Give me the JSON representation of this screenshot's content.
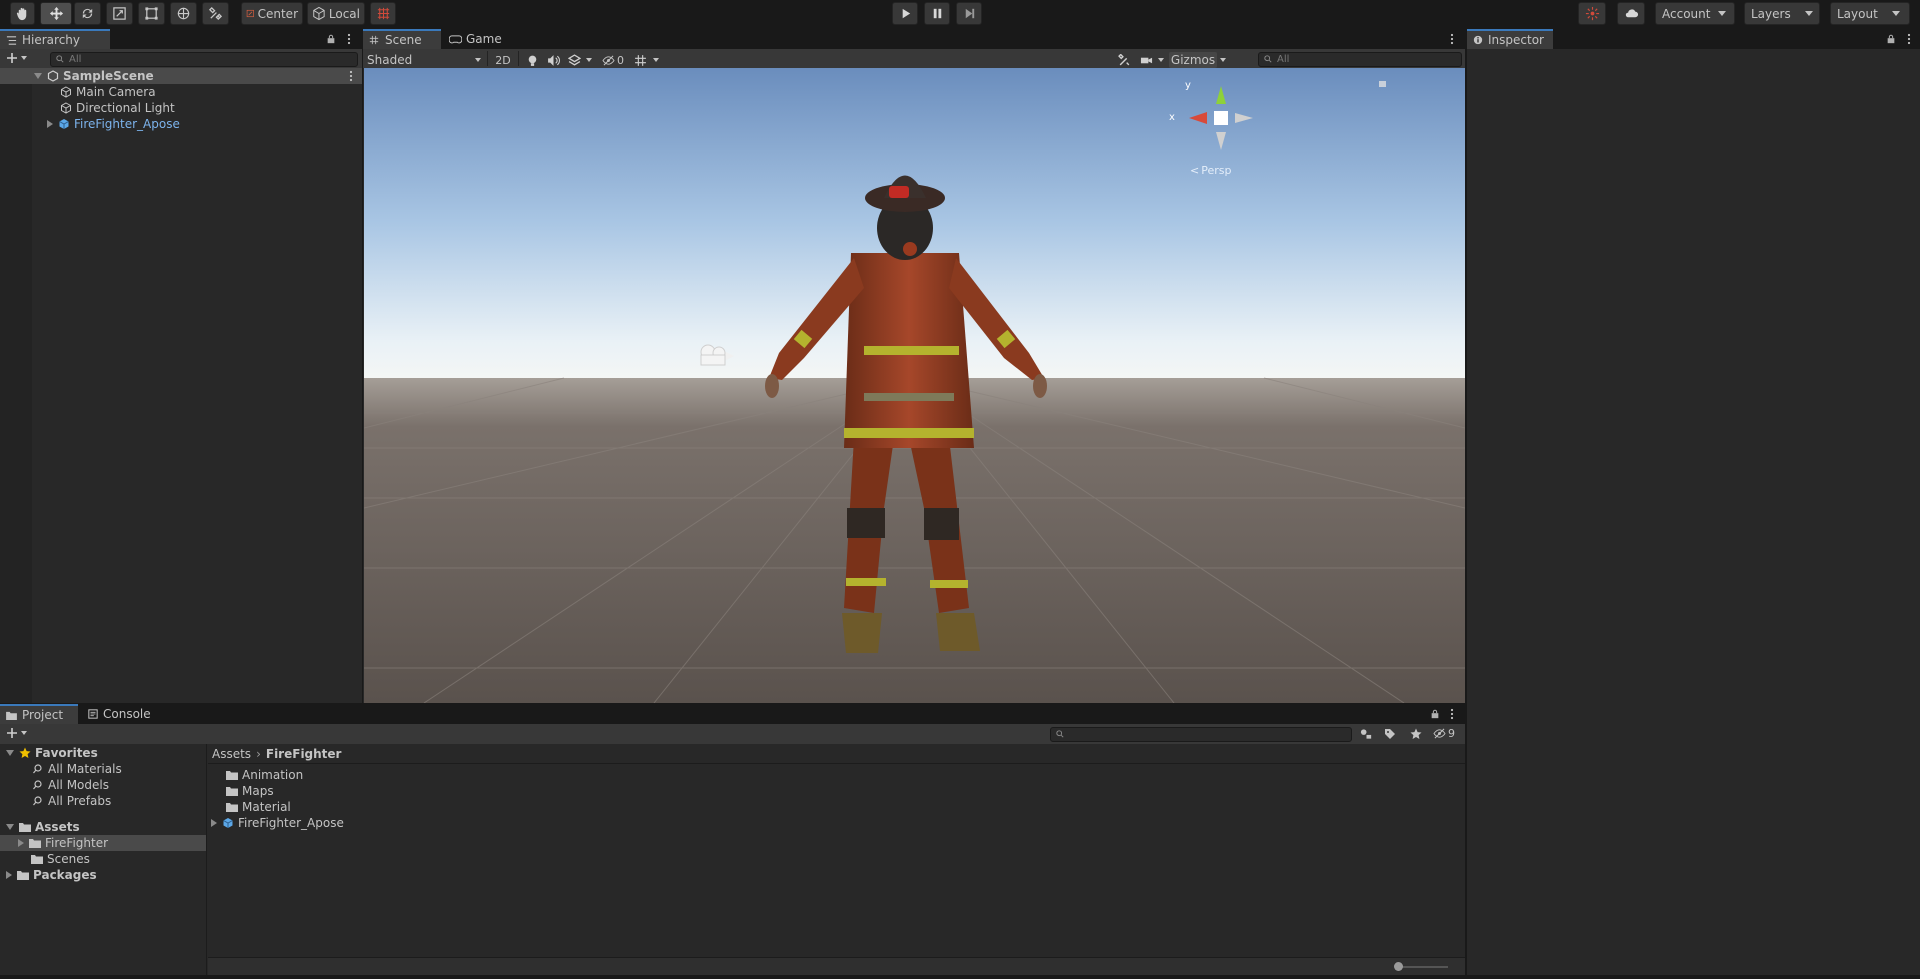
{
  "toolbar": {
    "pivot_label": "Center",
    "space_label": "Local",
    "account_label": "Account",
    "layers_label": "Layers",
    "layout_label": "Layout"
  },
  "hierarchy": {
    "tab_label": "Hierarchy",
    "search_placeholder": "All",
    "scene_name": "SampleScene",
    "items": [
      {
        "label": "Main Camera",
        "icon": "gameobject-icon"
      },
      {
        "label": "Directional Light",
        "icon": "gameobject-icon"
      },
      {
        "label": "FireFighter_Apose",
        "icon": "prefab-icon",
        "color": "#7cb3ec"
      }
    ]
  },
  "scene_view": {
    "tabs": [
      {
        "label": "Scene",
        "icon": "grid-icon"
      },
      {
        "label": "Game",
        "icon": "gamepad-icon"
      }
    ],
    "shading_mode": "Shaded",
    "toggle_2d": "2D",
    "hidden_count": "0",
    "gizmos_label": "Gizmos",
    "search_placeholder": "All",
    "projection_label": "Persp",
    "axis_x": "x",
    "axis_y": "y"
  },
  "inspector": {
    "tab_label": "Inspector"
  },
  "project": {
    "tabs": [
      {
        "label": "Project",
        "icon": "folder-icon"
      },
      {
        "label": "Console",
        "icon": "console-icon"
      }
    ],
    "hidden_count": "9",
    "favorites_label": "Favorites",
    "favorites": [
      "All Materials",
      "All Models",
      "All Prefabs"
    ],
    "assets_label": "Assets",
    "asset_tree": [
      "FireFighter",
      "Scenes"
    ],
    "packages_label": "Packages",
    "breadcrumb": [
      "Assets",
      "FireFighter"
    ],
    "contents": [
      {
        "label": "Animation",
        "icon": "folder-icon"
      },
      {
        "label": "Maps",
        "icon": "folder-icon"
      },
      {
        "label": "Material",
        "icon": "folder-icon"
      },
      {
        "label": "FireFighter_Apose",
        "icon": "prefab-icon"
      }
    ]
  },
  "colors": {
    "accent": "#3a79bb",
    "prefab_blue": "#7cb3ec",
    "panel_bg": "#282828",
    "toolbar_bg": "#191919",
    "sky_top": "#6a8fbe",
    "ground": "#5d5550"
  }
}
